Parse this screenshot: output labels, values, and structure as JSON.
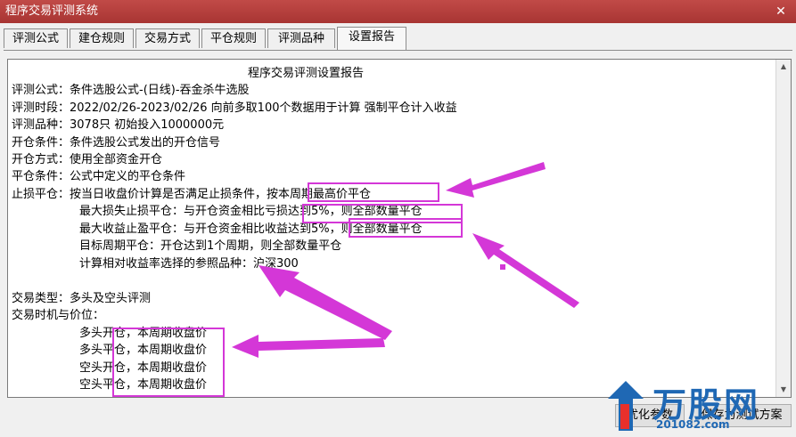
{
  "window": {
    "title": "程序交易评测系统",
    "close_glyph": "✕"
  },
  "tabs": [
    {
      "label": "评测公式"
    },
    {
      "label": "建仓规则"
    },
    {
      "label": "交易方式"
    },
    {
      "label": "平仓规则"
    },
    {
      "label": "评测品种"
    },
    {
      "label": "设置报告",
      "active": true
    }
  ],
  "report": {
    "title": "程序交易评测设置报告",
    "lines": [
      "评测公式：条件选股公式-(日线)-吞金杀牛选股",
      "评测时段：2022/02/26-2023/02/26 向前多取100个数据用于计算 强制平仓计入收益",
      "评测品种：3078只 初始投入1000000元",
      "开仓条件：条件选股公式发出的开仓信号",
      "开仓方式：使用全部资金开仓",
      "平仓条件：公式中定义的平仓条件",
      "止损平仓：按当日收盘价计算是否满足止损条件，按本周期最高价平仓",
      "最大损失止损平仓：与开仓资金相比亏损达到5%，则全部数量平仓",
      "最大收益止盈平仓：与开仓资金相比收益达到5%，则全部数量平仓",
      "目标周期平仓：开仓达到1个周期，则全部数量平仓",
      "计算相对收益率选择的参照品种：沪深300",
      "",
      "交易类型：多头及空头评测",
      "交易时机与价位：",
      "多头开仓，本周期收盘价",
      "多头平仓，本周期收盘价",
      "空头开仓，本周期收盘价",
      "空头平仓，本周期收盘价"
    ]
  },
  "buttons": {
    "optimize": "优化参数",
    "save_plan": "保存为测试方案"
  },
  "watermark": {
    "brand": "万股网",
    "domain": "201082.com"
  },
  "colors": {
    "titlebar": "#b33d3b",
    "highlight": "#d437d7",
    "logo_blue": "#1f68b4"
  }
}
